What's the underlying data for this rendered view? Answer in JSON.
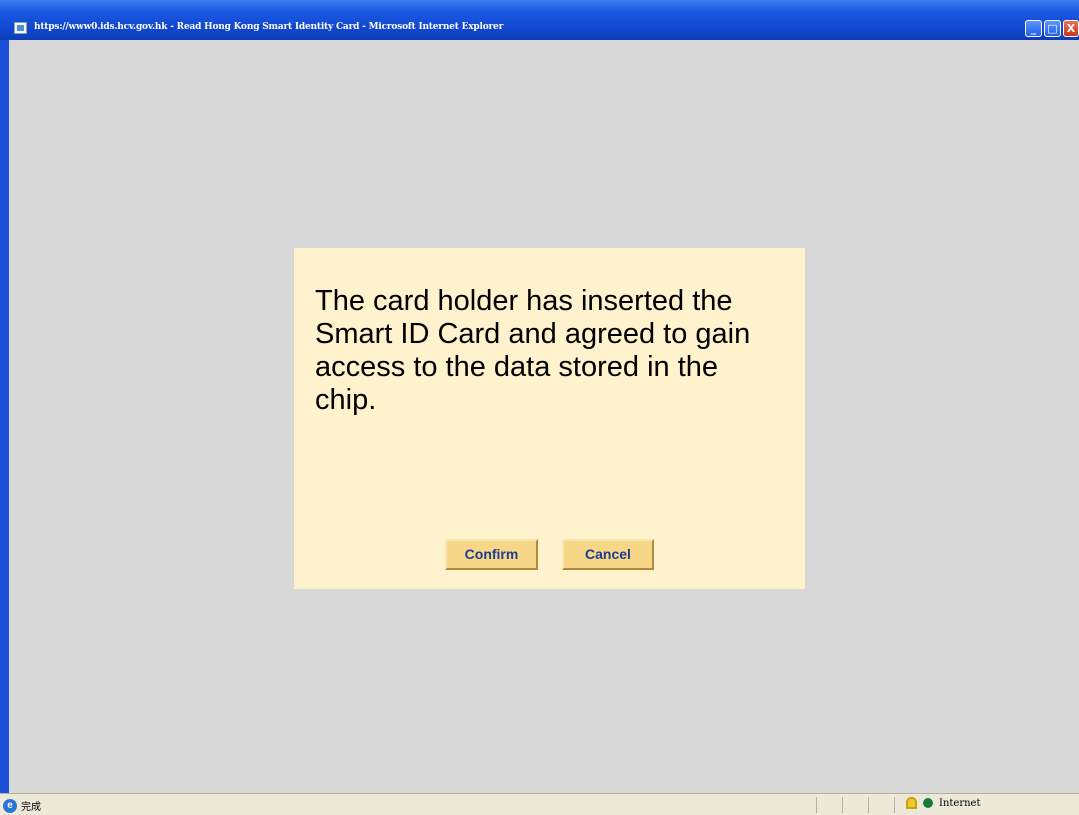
{
  "window": {
    "title": "https://www0.ids.hcv.gov.hk - Read Hong Kong Smart Identity Card - Microsoft Internet Explorer",
    "minimize_glyph": "_",
    "maximize_glyph": "□",
    "close_glyph": "X"
  },
  "dialog": {
    "message": "The card holder has inserted the Smart ID Card and agreed to gain access to the data stored in the chip.",
    "confirm_label": "Confirm",
    "cancel_label": "Cancel"
  },
  "statusbar": {
    "status_text": "完成",
    "zone_text": "Internet",
    "icons": [
      "ie-page-icon",
      "lock-icon",
      "globe-icon"
    ]
  },
  "colors": {
    "titlebar": "#1147d0",
    "client_background": "#d8d8d8",
    "dialog_background": "#fff2cc",
    "button_background": "#f7d688",
    "button_text": "#1d3c92"
  }
}
